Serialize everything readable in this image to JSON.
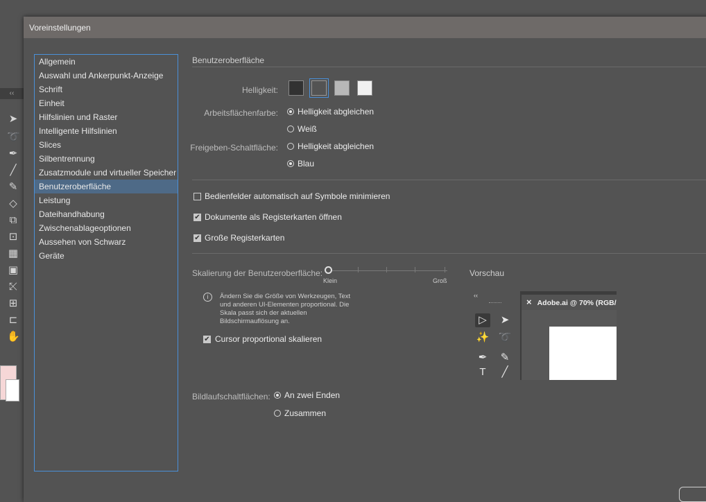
{
  "window": {
    "title": "Voreinstellungen"
  },
  "categories": [
    {
      "label": "Allgemein"
    },
    {
      "label": "Auswahl und Ankerpunkt-Anzeige"
    },
    {
      "label": "Schrift"
    },
    {
      "label": "Einheit"
    },
    {
      "label": "Hilfslinien und Raster"
    },
    {
      "label": "Intelligente Hilfslinien"
    },
    {
      "label": "Slices"
    },
    {
      "label": "Silbentrennung"
    },
    {
      "label": "Zusatzmodule und virtueller Speicher"
    },
    {
      "label": "Benutzeroberfläche",
      "selected": true
    },
    {
      "label": "Leistung"
    },
    {
      "label": "Dateihandhabung"
    },
    {
      "label": "Zwischenablageoptionen"
    },
    {
      "label": "Aussehen von Schwarz"
    },
    {
      "label": "Geräte"
    }
  ],
  "ui": {
    "section_title": "Benutzeroberfläche",
    "brightness": {
      "label": "Helligkeit:",
      "swatches": [
        "#323232",
        "#535353",
        "#b8b8b8",
        "#f0f0f0"
      ],
      "selected_index": 1
    },
    "canvas_color": {
      "label": "Arbeitsflächenfarbe:",
      "options": [
        "Helligkeit abgleichen",
        "Weiß"
      ],
      "selected_index": 0
    },
    "share_button": {
      "label": "Freigeben-Schaltfläche:",
      "options": [
        "Helligkeit abgleichen",
        "Blau"
      ],
      "selected_index": 1
    },
    "checkboxes": [
      {
        "label": "Bedienfelder automatisch auf Symbole minimieren",
        "checked": false
      },
      {
        "label": "Dokumente als Registerkarten öffnen",
        "checked": true
      },
      {
        "label": "Große Registerkarten",
        "checked": true
      }
    ],
    "scaling": {
      "label": "Skalierung der Benutzeroberfläche:",
      "min_label": "Klein",
      "max_label": "Groß",
      "level": 0,
      "info": "Ändern Sie die Größe von Werkzeugen, Text und anderen UI-Elementen proportional. Die Skala passt sich der aktuellen Bildschirmauflösung an.",
      "cursor_checkbox": {
        "label": "Cursor proportional skalieren",
        "checked": true
      }
    },
    "preview": {
      "label": "Vorschau",
      "doc_tab": "Adobe.ai @ 70% (RGB/"
    },
    "scroll_buttons": {
      "label": "Bildlaufschaltflächen:",
      "options": [
        "An zwei Enden",
        "Zusammen"
      ],
      "selected_index": 0
    }
  },
  "icons": {
    "check_glyph": "✔",
    "info_glyph": "i",
    "close_glyph": "×",
    "collapse_glyph": "‹‹"
  }
}
